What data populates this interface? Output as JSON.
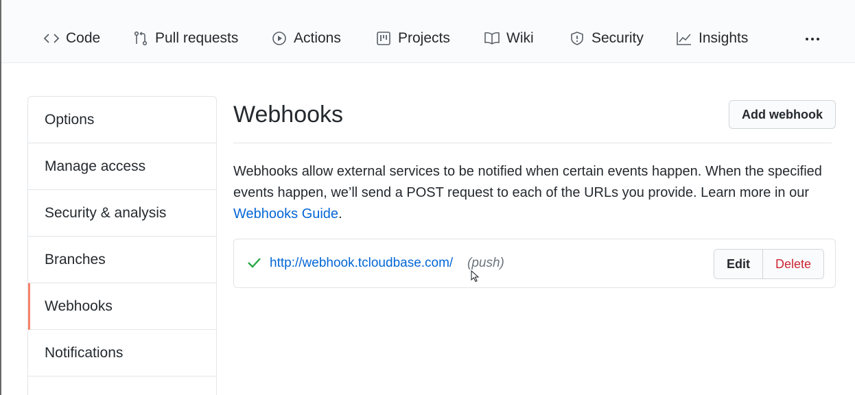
{
  "repo_nav": {
    "items": [
      {
        "label": "Code",
        "icon": "code-icon"
      },
      {
        "label": "Pull requests",
        "icon": "pull-request-icon"
      },
      {
        "label": "Actions",
        "icon": "play-icon"
      },
      {
        "label": "Projects",
        "icon": "project-icon"
      },
      {
        "label": "Wiki",
        "icon": "book-icon"
      },
      {
        "label": "Security",
        "icon": "shield-icon"
      },
      {
        "label": "Insights",
        "icon": "graph-icon"
      }
    ],
    "more_icon": "kebab-horizontal-icon"
  },
  "sidebar": {
    "items": [
      {
        "label": "Options"
      },
      {
        "label": "Manage access"
      },
      {
        "label": "Security & analysis"
      },
      {
        "label": "Branches"
      },
      {
        "label": "Webhooks",
        "selected": true
      },
      {
        "label": "Notifications"
      }
    ]
  },
  "main": {
    "title": "Webhooks",
    "add_button": "Add webhook",
    "description": "Webhooks allow external services to be notified when certain events happen. When the specified events happen, we’ll send a POST request to each of the URLs you provide. Learn more in our",
    "guide_link": "Webhooks Guide",
    "description_end": ".",
    "webhooks": [
      {
        "status_icon": "check-icon",
        "url": "http://webhook.tcloudbase.com/",
        "events": "(push)",
        "edit_label": "Edit",
        "delete_label": "Delete"
      }
    ]
  },
  "colors": {
    "link": "#0366d6",
    "success": "#28a745",
    "danger": "#cb2431",
    "selected_accent": "#f9826c"
  }
}
